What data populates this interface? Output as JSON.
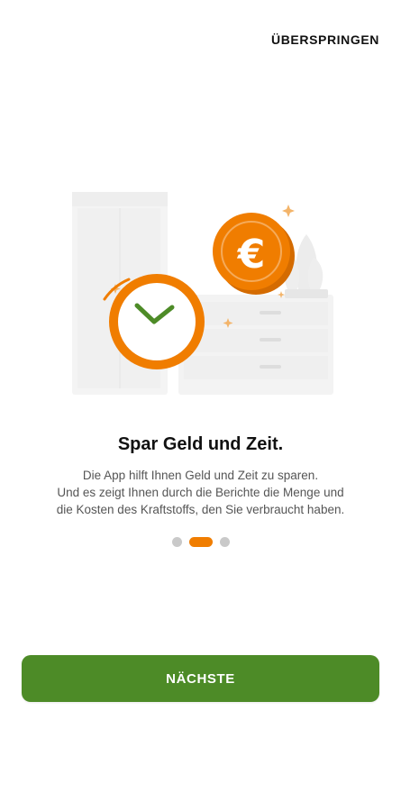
{
  "header": {
    "skip_label": "ÜBERSPRINGEN"
  },
  "illustration": {
    "coin_symbol": "€",
    "clock_icon": "check-clock-icon",
    "coin_icon": "euro-coin-icon"
  },
  "content": {
    "title": "Spar Geld und Zeit.",
    "description_lines": [
      "Die App hilft Ihnen Geld und Zeit zu sparen.",
      "Und es zeigt Ihnen durch die Berichte die Menge und",
      "die Kosten des Kraftstoffs, den Sie verbraucht haben."
    ]
  },
  "pager": {
    "total": 3,
    "active_index": 1
  },
  "footer": {
    "next_label": "NÄCHSTE"
  },
  "colors": {
    "accent": "#f07d00",
    "primary_button": "#4d8b27",
    "check": "#4d8b27"
  }
}
